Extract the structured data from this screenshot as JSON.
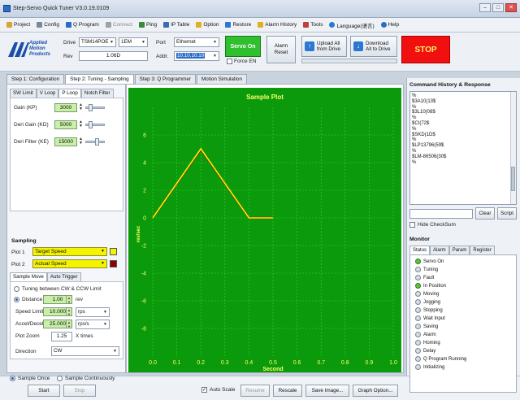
{
  "window": {
    "title": "Step-Servo Quick Tuner V3.0.19.0109",
    "controls": [
      "–",
      "□",
      "✕"
    ]
  },
  "menu": [
    {
      "label": "Project",
      "icon": "project-icon",
      "color": "#d8a13a"
    },
    {
      "label": "Config",
      "icon": "config-icon",
      "color": "#7a8896"
    },
    {
      "label": "Q Program",
      "icon": "q-program-icon",
      "color": "#2a6cc8"
    },
    {
      "label": "Connect",
      "icon": "connect-icon",
      "color": "#9aa2ab"
    },
    {
      "label": "Ping",
      "icon": "ping-icon",
      "color": "#3a8a3a"
    },
    {
      "label": "IP Table",
      "icon": "ip-table-icon",
      "color": "#3a6bb8"
    },
    {
      "label": "Option",
      "icon": "option-icon",
      "color": "#e0b020"
    },
    {
      "label": "Restore",
      "icon": "restore-icon",
      "color": "#2a78d2"
    },
    {
      "label": "Alarm History",
      "icon": "alarm-icon",
      "color": "#e0b020"
    },
    {
      "label": "Tools",
      "icon": "tools-icon",
      "color": "#c04040"
    },
    {
      "label": "Language(语言)",
      "icon": "language-icon",
      "color": "#2a78d2"
    },
    {
      "label": "Help",
      "icon": "help-icon",
      "color": "#2a6cc8"
    }
  ],
  "logo": {
    "line1": "Applied",
    "line2": "Motion",
    "line3": "Products"
  },
  "drive": {
    "label": "Drive",
    "value": "TSM14POE",
    "suffix": "1EM",
    "rev_label": "Rev",
    "rev_value": "1.06D"
  },
  "port": {
    "label": "Port",
    "value": "Ethernet",
    "addr_label": "Addr.",
    "addr_value": "10.10.10.10",
    "force_en": "Force EN"
  },
  "buttons": {
    "servo_on": "Servo On",
    "alarm_reset_1": "Alarm",
    "alarm_reset_2": "Reset",
    "upload_1": "Upload All",
    "upload_2": "from Drive",
    "download_1": "Download",
    "download_2": "All to Drive",
    "stop": "STOP"
  },
  "tabs": [
    "Step 1: Configuration",
    "Step 2: Tuning - Sampling",
    "Step 3: Q Programmer",
    "Motion Simulation"
  ],
  "subtabs": [
    "SW Limit",
    "V Loop",
    "P Loop",
    "Notch Filter"
  ],
  "gains": [
    {
      "label": "Gain (KP)",
      "value": "3000"
    },
    {
      "label": "Deri Gain (KD)",
      "value": "5000"
    },
    {
      "label": "Deri Filter (KE)",
      "value": "15000"
    }
  ],
  "sampling": {
    "title": "Sampling",
    "plot1_label": "Plot 1",
    "plot1_value": "Target Speed",
    "plot1_color": "#f4f400",
    "plot2_label": "Plot 2",
    "plot2_value": "Actual Speed",
    "plot2_color": "#8b0000"
  },
  "move_tabs": [
    "Sample Move",
    "Auto Trigger"
  ],
  "move": {
    "tuning_option": "Tuning between CW & CCW Limit",
    "distance_label": "Distance",
    "distance_value": "1.00",
    "distance_unit": "rev",
    "speed_label": "Speed Limit",
    "speed_value": "10.000",
    "speed_unit": "rps",
    "accel_label": "Accel/Decel",
    "accel_value": "25.000",
    "accel_unit": "rps/s",
    "zoom_label": "Plot Zoom",
    "zoom_value": "1.25",
    "zoom_unit": "X times",
    "direction_label": "Direction",
    "direction_value": "CW"
  },
  "bottom": {
    "sample_once": "Sample Once",
    "sample_cont": "Sample Continuously",
    "start": "Start",
    "stop": "Stop",
    "auto_scale": "Auto Scale",
    "resume": "Resume",
    "rescale": "Rescale",
    "save_image": "Save Image...",
    "graph_option": "Graph Option..."
  },
  "chart_data": {
    "type": "line",
    "title": "Sample Plot",
    "xlabel": "Second",
    "ylabel": "rev/sec",
    "xlim": [
      0.0,
      1.0
    ],
    "ylim": [
      -10,
      8
    ],
    "xticks": [
      "0.0",
      "0.1",
      "0.2",
      "0.3",
      "0.4",
      "0.5",
      "0.6",
      "0.7",
      "0.8",
      "0.9",
      "1.0"
    ],
    "yticks": [
      "6",
      "4",
      "2",
      "0",
      "-2",
      "-4",
      "-6",
      "-8"
    ],
    "grid": true,
    "series": [
      {
        "color": "#f4f400",
        "x": [
          0.0,
          0.2,
          0.4,
          0.5
        ],
        "y": [
          0,
          5,
          0,
          0
        ]
      },
      {
        "color": "#a31515",
        "x": [
          0.0,
          0.2,
          0.4,
          0.5
        ],
        "y": [
          0,
          4.95,
          0,
          0
        ]
      }
    ]
  },
  "cmd": {
    "title": "Command History & Response",
    "lines": [
      "%",
      "$3A10(13$",
      "%",
      "$3L10(08$",
      "%",
      "$CI(72$",
      "%",
      "$SKD(1D$",
      "%",
      "$LP13796(59$",
      "%",
      "$LM-86506(30$",
      "%"
    ],
    "clear": "Clear",
    "script": "Script",
    "hide_checksum": "Hide CheckSum"
  },
  "monitor": {
    "title": "Monitor",
    "tabs": [
      "Status",
      "Alarm",
      "Param",
      "Register"
    ],
    "items": [
      {
        "label": "Servo On",
        "on": true
      },
      {
        "label": "Tuning",
        "on": false
      },
      {
        "label": "Fault",
        "on": false
      },
      {
        "label": "In Position",
        "on": true
      },
      {
        "label": "Moving",
        "on": false
      },
      {
        "label": "Jogging",
        "on": false
      },
      {
        "label": "Stopping",
        "on": false
      },
      {
        "label": "Wait Input",
        "on": false
      },
      {
        "label": "Saving",
        "on": false
      },
      {
        "label": "Alarm",
        "on": false
      },
      {
        "label": "Homing",
        "on": false
      },
      {
        "label": "Delay",
        "on": false
      },
      {
        "label": "Q Program Running",
        "on": false
      },
      {
        "label": "Initializing",
        "on": false
      }
    ]
  }
}
